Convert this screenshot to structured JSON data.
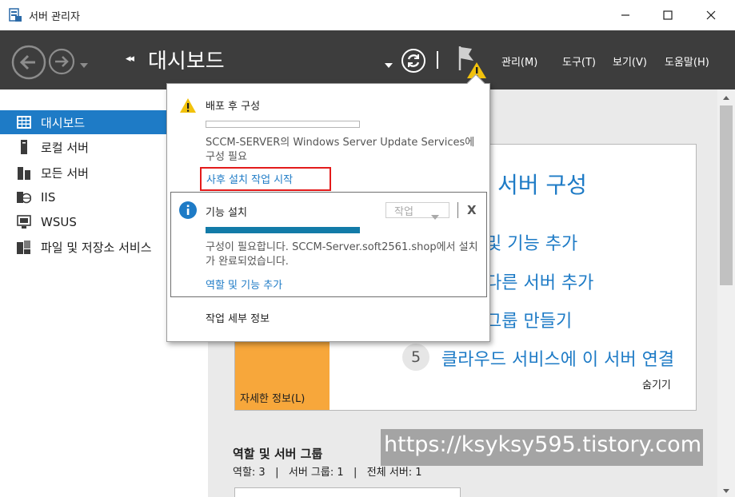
{
  "window": {
    "title": "서버 관리자",
    "icons": {
      "app": "server-manager-icon",
      "minimize": "minimize-icon",
      "maximize": "maximize-icon",
      "close": "close-icon"
    }
  },
  "toolbar": {
    "breadcrumb_arrows": "◂◂",
    "page_title": "대시보드",
    "menus": {
      "manage": "관리(M)",
      "tools": "도구(T)",
      "view": "보기(V)",
      "help": "도움말(H)"
    }
  },
  "sidebar": {
    "items": [
      {
        "label": "대시보드",
        "icon": "dashboard-grid-icon",
        "active": true
      },
      {
        "label": "로컬 서버",
        "icon": "local-server-icon",
        "active": false
      },
      {
        "label": "모든 서버",
        "icon": "all-servers-icon",
        "active": false
      },
      {
        "label": "IIS",
        "icon": "iis-icon",
        "active": false
      },
      {
        "label": "WSUS",
        "icon": "wsus-icon",
        "active": false
      },
      {
        "label": "파일 및 저장소 서비스",
        "icon": "file-storage-icon",
        "active": false
      }
    ]
  },
  "welcome": {
    "heading": "서버 구성",
    "steps": [
      {
        "num": "",
        "label": "및 기능 추가"
      },
      {
        "num": "",
        "label": "다른 서버 추가"
      },
      {
        "num": "",
        "label": "그룹 만들기"
      },
      {
        "num": "5",
        "label": "클라우드 서비스에 이 서버 연결"
      }
    ],
    "more_info": "자세한 정보(L)",
    "hide": "숨기기"
  },
  "roles": {
    "title": "역할 및 서버 그룹",
    "stats": "역할: 3   |   서버 그룹: 1   |   전체 서버: 1"
  },
  "notifications": {
    "items": [
      {
        "title": "배포 후 구성",
        "progress": 0.0,
        "message": "SCCM-SERVER의 Windows Server Update Services에 구성 필요",
        "link": "사후 설치 작업 시작"
      },
      {
        "title": "기능 설치",
        "progress": 1.0,
        "task_label": "작업",
        "close_label": "X",
        "message": "구성이 필요합니다. SCCM-Server.soft2561.shop에서 설치가 완료되었습니다.",
        "link": "역할 및 기능 추가"
      }
    ],
    "task_details": "작업 세부 정보"
  },
  "watermark": "https://ksyksy595.tistory.com",
  "colors": {
    "accent": "#1e7bc6",
    "toolbar": "#3d3d3d",
    "orange": "#f7a73b",
    "progress": "#127ba8",
    "highlight": "#e31b1b"
  }
}
